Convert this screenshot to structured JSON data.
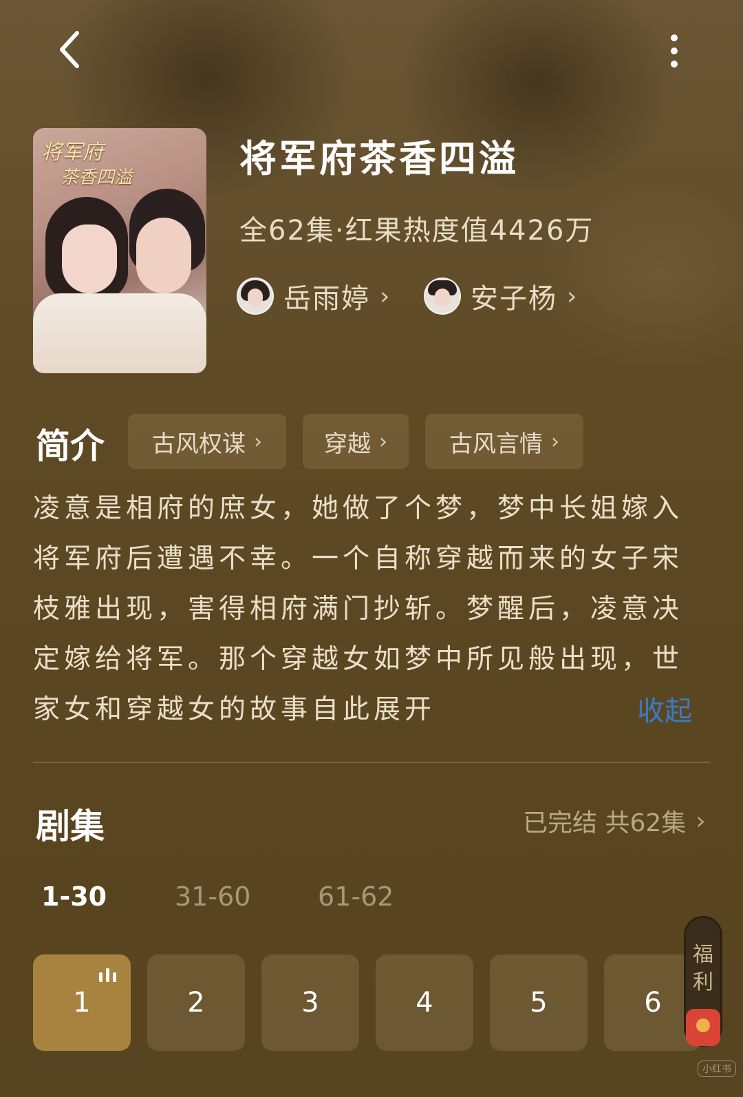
{
  "header": {
    "back_icon": "chevron-left-icon",
    "more_icon": "more-vertical-icon"
  },
  "show": {
    "title": "将军府茶香四溢",
    "meta": "全62集·红果热度值4426万",
    "actors": [
      {
        "name": "岳雨婷"
      },
      {
        "name": "安子杨"
      }
    ]
  },
  "intro": {
    "heading": "简介",
    "tags": [
      "古风权谋",
      "穿越",
      "古风言情"
    ],
    "description": "凌意是相府的庶女，她做了个梦，梦中长姐嫁入将军府后遭遇不幸。一个自称穿越而来的女子宋枝雅出现，害得相府满门抄斩。梦醒后，凌意决定嫁给将军。那个穿越女如梦中所见般出现，世家女和穿越女的故事自此展开",
    "collapse_label": "收起"
  },
  "episodes": {
    "heading": "剧集",
    "status": "已完结 共62集",
    "ranges": [
      "1-30",
      "31-60",
      "61-62"
    ],
    "selected_range": "1-30",
    "items": [
      "1",
      "2",
      "3",
      "4",
      "5",
      "6"
    ],
    "current": "1"
  },
  "welfare": {
    "label_1": "福",
    "label_2": "利"
  },
  "watermark": "小红书",
  "colors": {
    "accent_active_episode": "#a8833f",
    "collapse_link": "#3a7ac8"
  }
}
